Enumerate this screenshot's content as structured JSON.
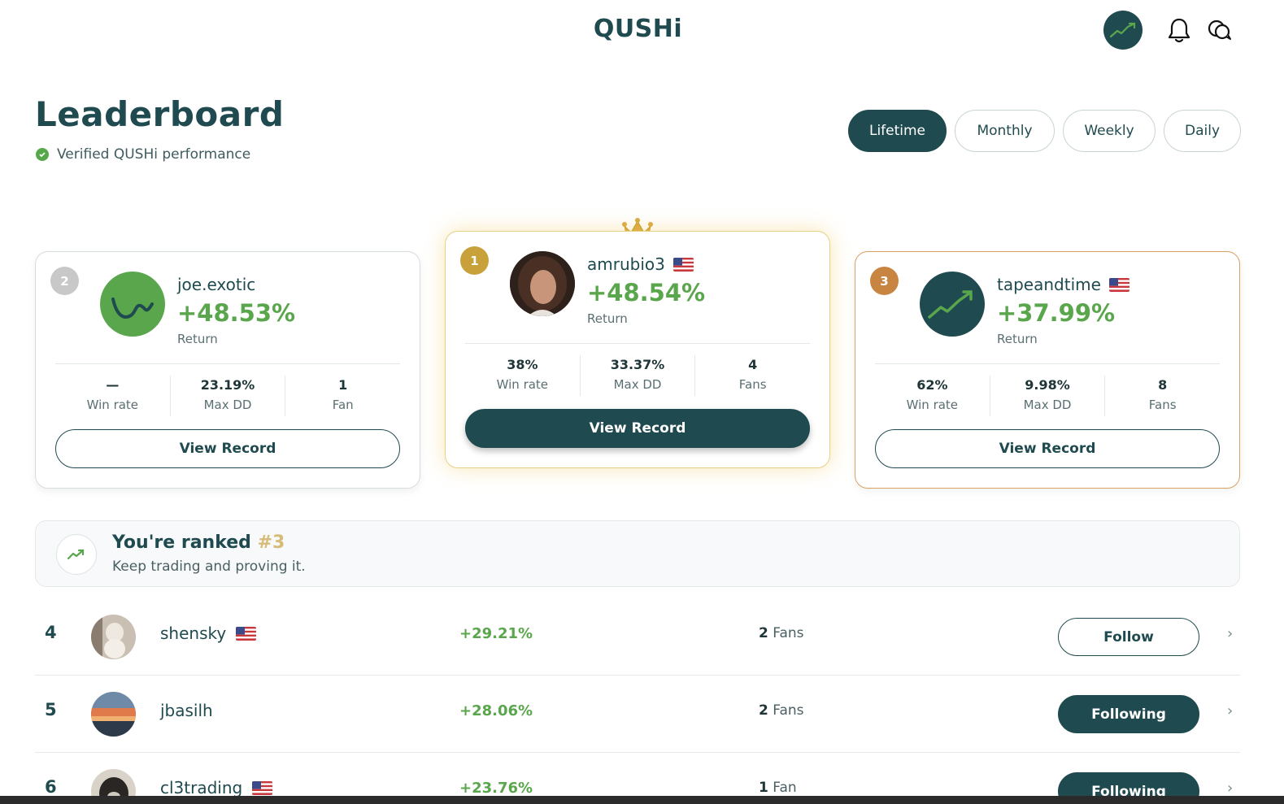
{
  "header": {
    "logo": "QUSHi",
    "avatar_icon": "trend-chart-icon",
    "notifications_icon": "bell-icon",
    "messages_icon": "chat-bubbles-icon"
  },
  "page": {
    "title": "Leaderboard",
    "subtitle": "Verified QUSHi performance"
  },
  "periods": [
    "Lifetime",
    "Monthly",
    "Weekly",
    "Daily"
  ],
  "active_period": "Lifetime",
  "podium": {
    "first": {
      "rank": "1",
      "username": "amrubio3",
      "country": "US",
      "return": "+48.54%",
      "return_label": "Return",
      "stats": [
        {
          "value": "38%",
          "label": "Win rate"
        },
        {
          "value": "33.37%",
          "label": "Max DD"
        },
        {
          "value": "4",
          "label": "Fans"
        }
      ],
      "button": "View Record"
    },
    "second": {
      "rank": "2",
      "username": "joe.exotic",
      "country": "",
      "return": "+48.53%",
      "return_label": "Return",
      "stats": [
        {
          "value": "—",
          "label": "Win rate"
        },
        {
          "value": "23.19%",
          "label": "Max DD"
        },
        {
          "value": "1",
          "label": "Fan"
        }
      ],
      "button": "View Record"
    },
    "third": {
      "rank": "3",
      "username": "tapeandtime",
      "country": "US",
      "return": "+37.99%",
      "return_label": "Return",
      "stats": [
        {
          "value": "62%",
          "label": "Win rate"
        },
        {
          "value": "9.98%",
          "label": "Max DD"
        },
        {
          "value": "8",
          "label": "Fans"
        }
      ],
      "button": "View Record"
    }
  },
  "my_rank": {
    "title_prefix": "You're ranked",
    "rank": "#3",
    "subtitle": "Keep trading and proving it."
  },
  "list": [
    {
      "rank": "4",
      "username": "shensky",
      "country": "US",
      "return": "+29.21%",
      "fans_count": "2",
      "fans_label": "Fans",
      "action": "Follow"
    },
    {
      "rank": "5",
      "username": "jbasilh",
      "country": "",
      "return": "+28.06%",
      "fans_count": "2",
      "fans_label": "Fans",
      "action": "Following"
    },
    {
      "rank": "6",
      "username": "cl3trading",
      "country": "US",
      "return": "+23.76%",
      "fans_count": "1",
      "fans_label": "Fan",
      "action": "Following"
    }
  ],
  "colors": {
    "primary": "#1f4a4f",
    "positive": "#5aa64c",
    "gold": "#c9a13a",
    "bronze": "#c88542",
    "silver": "#c8c8c8"
  }
}
